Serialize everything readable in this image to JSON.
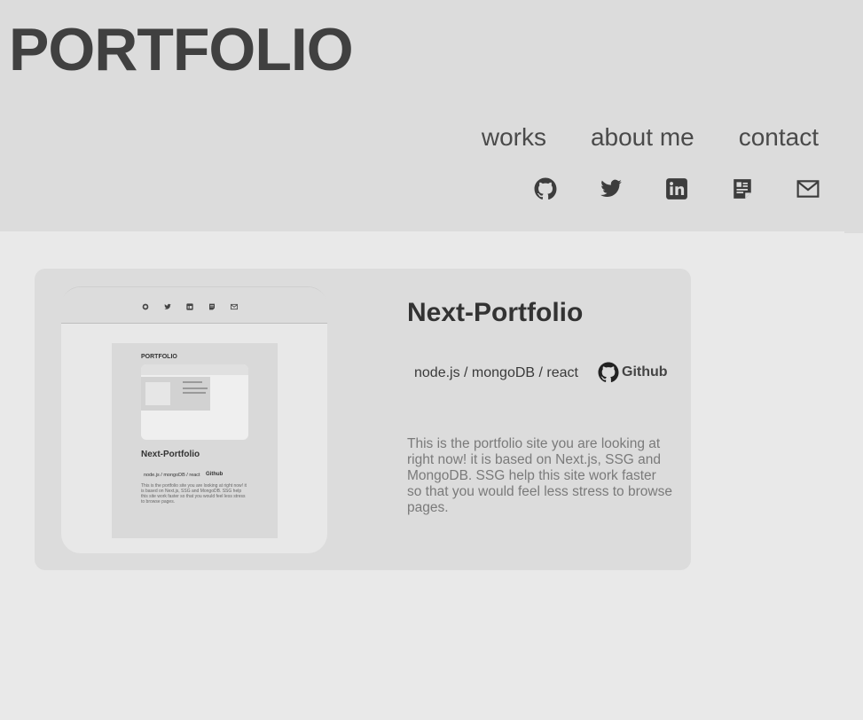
{
  "site": {
    "title": "PORTFOLIO"
  },
  "nav": {
    "items": [
      {
        "label": "works"
      },
      {
        "label": "about me"
      },
      {
        "label": "contact"
      }
    ]
  },
  "socials": [
    {
      "icon": "github-icon"
    },
    {
      "icon": "twitter-icon"
    },
    {
      "icon": "linkedin-icon"
    },
    {
      "icon": "resume-icon"
    },
    {
      "icon": "mail-icon"
    }
  ],
  "project": {
    "title": "Next-Portfolio",
    "tags": "node.js / mongoDB / react",
    "github_label": "Github",
    "description": "This is the portfolio site you are looking at right now! it is based on Next.js, SSG and MongoDB. SSG help this site work faster so that you would feel less stress to browse pages.",
    "thumbnail": {
      "mini_title": "PORTFOLIO",
      "mini_project_title": "Next-Portfolio",
      "mini_tags": "node.js / mongoDB / react",
      "mini_github": "Github",
      "mini_description": "This is the portfolio site you are looking at right now! it is based on Next.js, SSG and MongoDB. SSG help this site work faster so that you would feel less stress to browse pages."
    }
  },
  "colors": {
    "header_bg": "#dcdcdc",
    "page_bg": "#e9e9e9",
    "card_bg": "#dcdcdc",
    "title": "#404040"
  }
}
